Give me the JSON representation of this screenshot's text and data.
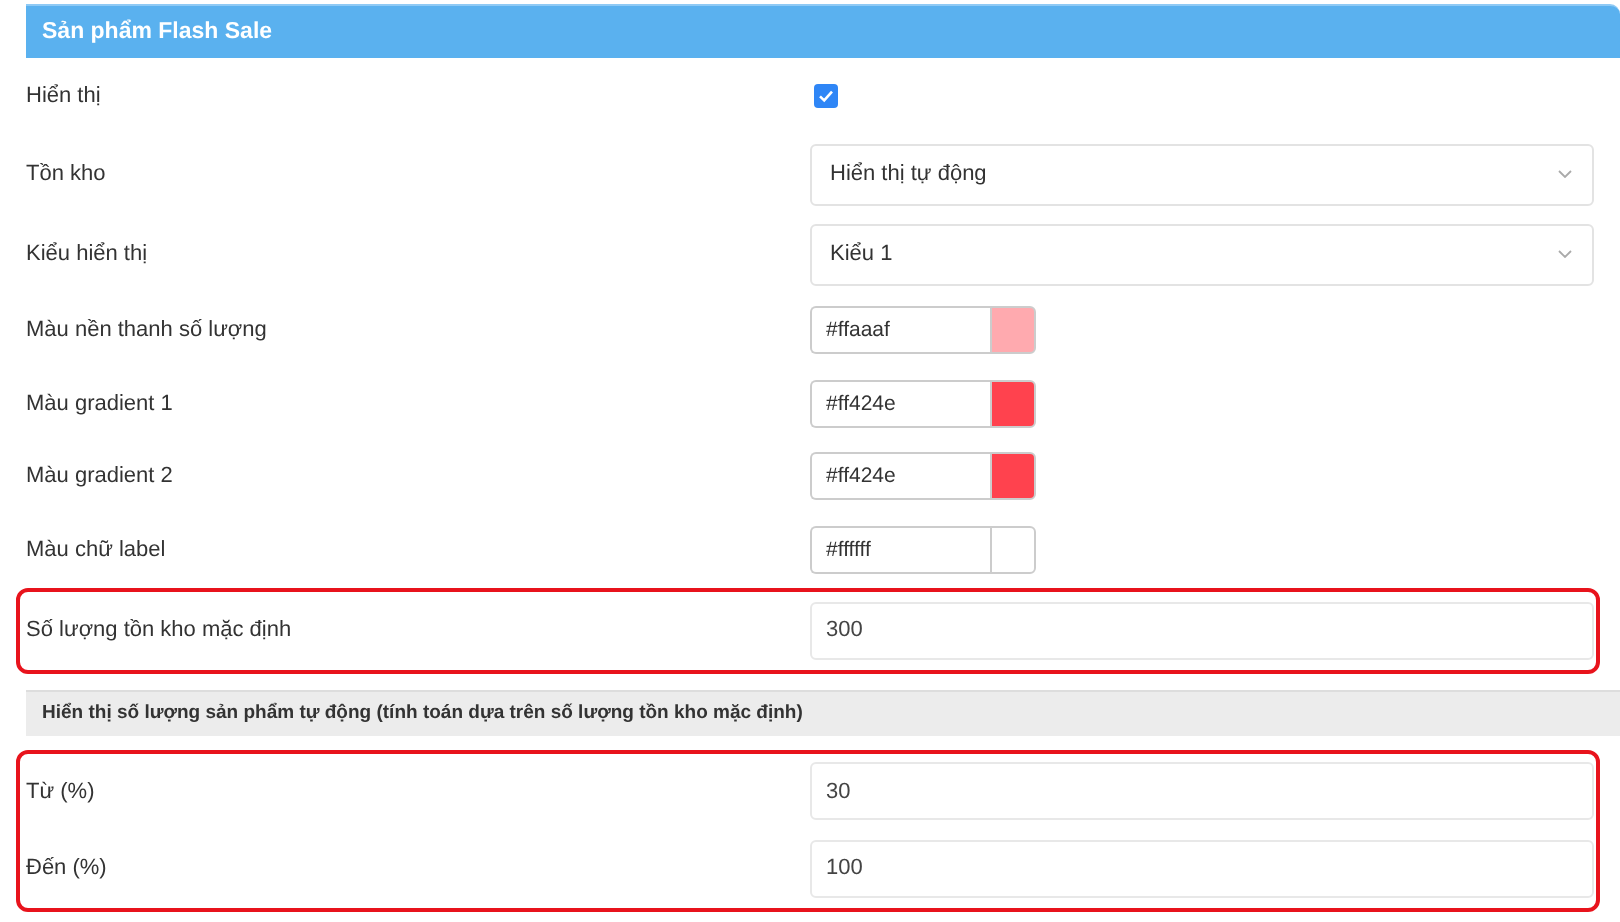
{
  "header": {
    "title": "Sản phẩm Flash Sale"
  },
  "sections": [
    {
      "kind": "rows",
      "highlighted": false,
      "rows": [
        {
          "kind": "checkbox",
          "label": "Hiển thị",
          "checked": true
        },
        {
          "kind": "select",
          "label": "Tồn kho",
          "value": "Hiển thị tự động"
        },
        {
          "kind": "select",
          "label": "Kiểu hiển thị",
          "value": "Kiểu 1"
        },
        {
          "kind": "color",
          "label": "Màu nền thanh số lượng",
          "value": "#ffaaaf",
          "color": "#ffaaaf"
        },
        {
          "kind": "color",
          "label": "Màu gradient 1",
          "value": "#ff424e",
          "color": "#ff424e"
        },
        {
          "kind": "color",
          "label": "Màu gradient 2",
          "value": "#ff424e",
          "color": "#ff424e"
        },
        {
          "kind": "color",
          "label": "Màu chữ label",
          "value": "#ffffff",
          "color": "#ffffff"
        }
      ]
    },
    {
      "kind": "rows",
      "highlighted": true,
      "rows": [
        {
          "kind": "number",
          "label": "Số lượng tồn kho mặc định",
          "value": "300"
        }
      ]
    },
    {
      "kind": "heading",
      "text": "Hiển thị số lượng sản phẩm tự động (tính toán dựa trên số lượng tồn kho mặc định)"
    },
    {
      "kind": "rows",
      "highlighted": true,
      "rows": [
        {
          "kind": "number",
          "label": "Từ (%)",
          "value": "30"
        },
        {
          "kind": "number",
          "label": "Đến (%)",
          "value": "100"
        }
      ]
    }
  ]
}
